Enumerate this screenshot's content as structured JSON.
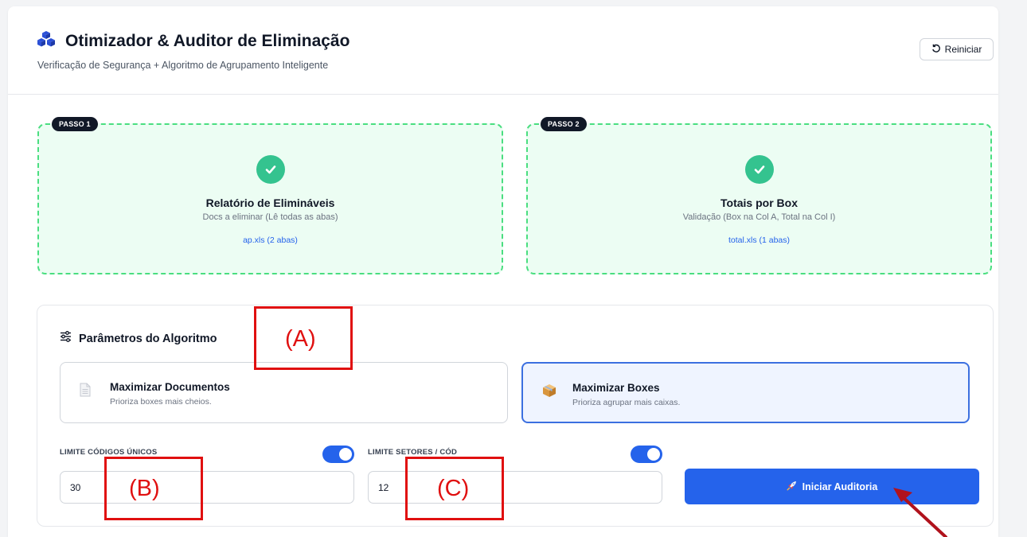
{
  "header": {
    "title": "Otimizador & Auditor de Eliminação",
    "subtitle": "Verificação de Segurança + Algoritmo de Agrupamento Inteligente",
    "reset_label": "Reiniciar"
  },
  "steps": [
    {
      "badge": "PASSO 1",
      "title": "Relatório de Elimináveis",
      "description": "Docs a eliminar (Lê todas as abas)",
      "file": "ap.xls (2 abas)"
    },
    {
      "badge": "PASSO 2",
      "title": "Totais por Box",
      "description": "Validação (Box na Col A, Total na Col I)",
      "file": "total.xls (1 abas)"
    }
  ],
  "params": {
    "title": "Parâmetros do Algoritmo",
    "modes": [
      {
        "title": "Maximizar Documentos",
        "description": "Prioriza boxes mais cheios.",
        "selected": false
      },
      {
        "title": "Maximizar Boxes",
        "description": "Prioriza agrupar mais caixas.",
        "selected": true
      }
    ],
    "limit_codes": {
      "label": "LIMITE CÓDIGOS ÚNICOS",
      "value": "30",
      "enabled": true
    },
    "limit_sectors": {
      "label": "LIMITE SETORES / CÓD",
      "value": "12",
      "enabled": true
    },
    "start_label": "Iniciar Auditoria"
  },
  "annotations": {
    "a": "(A)",
    "b": "(B)",
    "c": "(C)"
  },
  "colors": {
    "accent": "#2563eb",
    "success": "#34c38f",
    "annotation": "#e01010"
  }
}
